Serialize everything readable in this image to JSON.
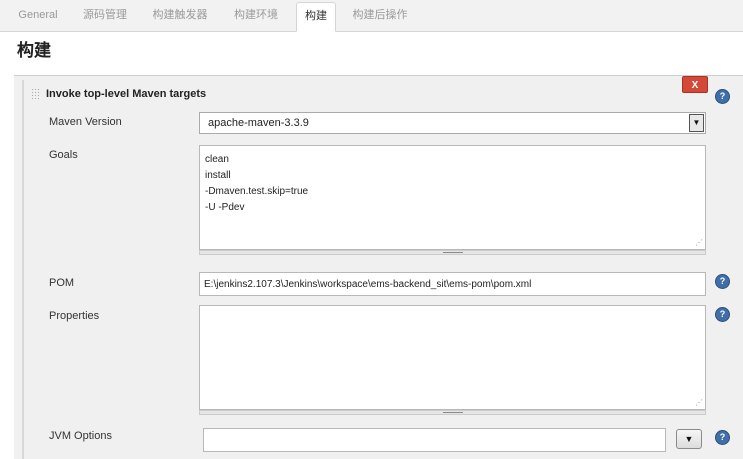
{
  "tabs": [
    {
      "label": "General"
    },
    {
      "label": "源码管理"
    },
    {
      "label": "构建触发器"
    },
    {
      "label": "构建环境"
    },
    {
      "label": "构建"
    },
    {
      "label": "构建后操作"
    }
  ],
  "active_tab": "构建",
  "page_title": "构建",
  "step": {
    "title": "Invoke top-level Maven targets",
    "delete_label": "X",
    "help_icon": "?"
  },
  "fields": {
    "maven_version": {
      "label": "Maven Version",
      "value": "apache-maven-3.3.9",
      "arrow": "▼"
    },
    "goals": {
      "label": "Goals",
      "lines": [
        "clean",
        "install",
        "-Dmaven.test.skip=true",
        "-U -Pdev"
      ]
    },
    "pom": {
      "label": "POM",
      "value": "E:\\jenkins2.107.3\\Jenkins\\workspace\\ems-backend_sit\\ems-pom\\pom.xml"
    },
    "properties": {
      "label": "Properties",
      "value": ""
    },
    "jvm_options": {
      "label": "JVM Options",
      "value": "",
      "arrow": "▼"
    }
  },
  "colors": {
    "delete_button": "#d24939",
    "help_icon": "#3f6ea8",
    "panel_background": "#f0f0f0"
  }
}
